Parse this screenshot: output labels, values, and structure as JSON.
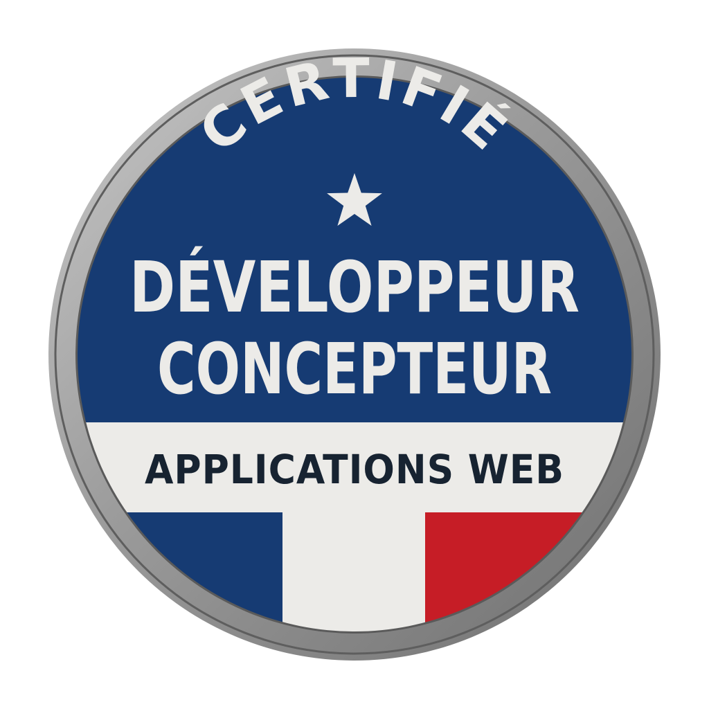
{
  "badge": {
    "arc_label": "CERTIFIÉ",
    "title_line_1": "DÉVELOPPEUR",
    "title_line_2": "CONCEPTEUR",
    "band_label": "APPLICATIONS WEB",
    "emblem_icon": "star-icon",
    "flag": "french-tricolor"
  },
  "colors": {
    "navy": "#163b73",
    "white": "#ecebe8",
    "red": "#c61d26",
    "band_text": "#172331",
    "ring": "#8f8f8f"
  }
}
